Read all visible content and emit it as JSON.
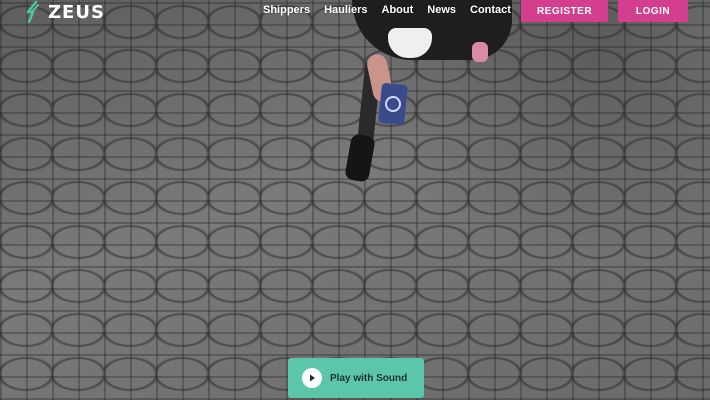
{
  "brand": {
    "name": "ZEUS",
    "accent_color": "#d43f8d",
    "logo_icon": "zeus-logo-icon"
  },
  "nav": {
    "items": [
      {
        "label": "Shippers"
      },
      {
        "label": "Hauliers"
      },
      {
        "label": "About"
      },
      {
        "label": "News"
      },
      {
        "label": "Contact"
      }
    ]
  },
  "auth": {
    "register_label": "REGISTER",
    "login_label": "LOGIN"
  },
  "hero": {
    "play_label": "Play with Sound",
    "play_icon": "play-icon",
    "play_color": "#5cc6ab"
  }
}
